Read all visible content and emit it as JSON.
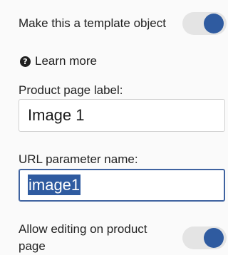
{
  "template_toggle": {
    "label": "Make this a template object",
    "state": "on"
  },
  "help": {
    "icon": "question-circle-icon",
    "glyph": "?",
    "label": "Learn more"
  },
  "product_page_label": {
    "label": "Product page label:",
    "value": "Image 1"
  },
  "url_parameter": {
    "label": "URL parameter name:",
    "value": "image1"
  },
  "editing_toggle": {
    "label_line1": "Allow editing on product",
    "label_line2": "page",
    "state": "on"
  },
  "colors": {
    "accent": "#2f5ba0",
    "toggle_track": "#e4e4e4"
  }
}
